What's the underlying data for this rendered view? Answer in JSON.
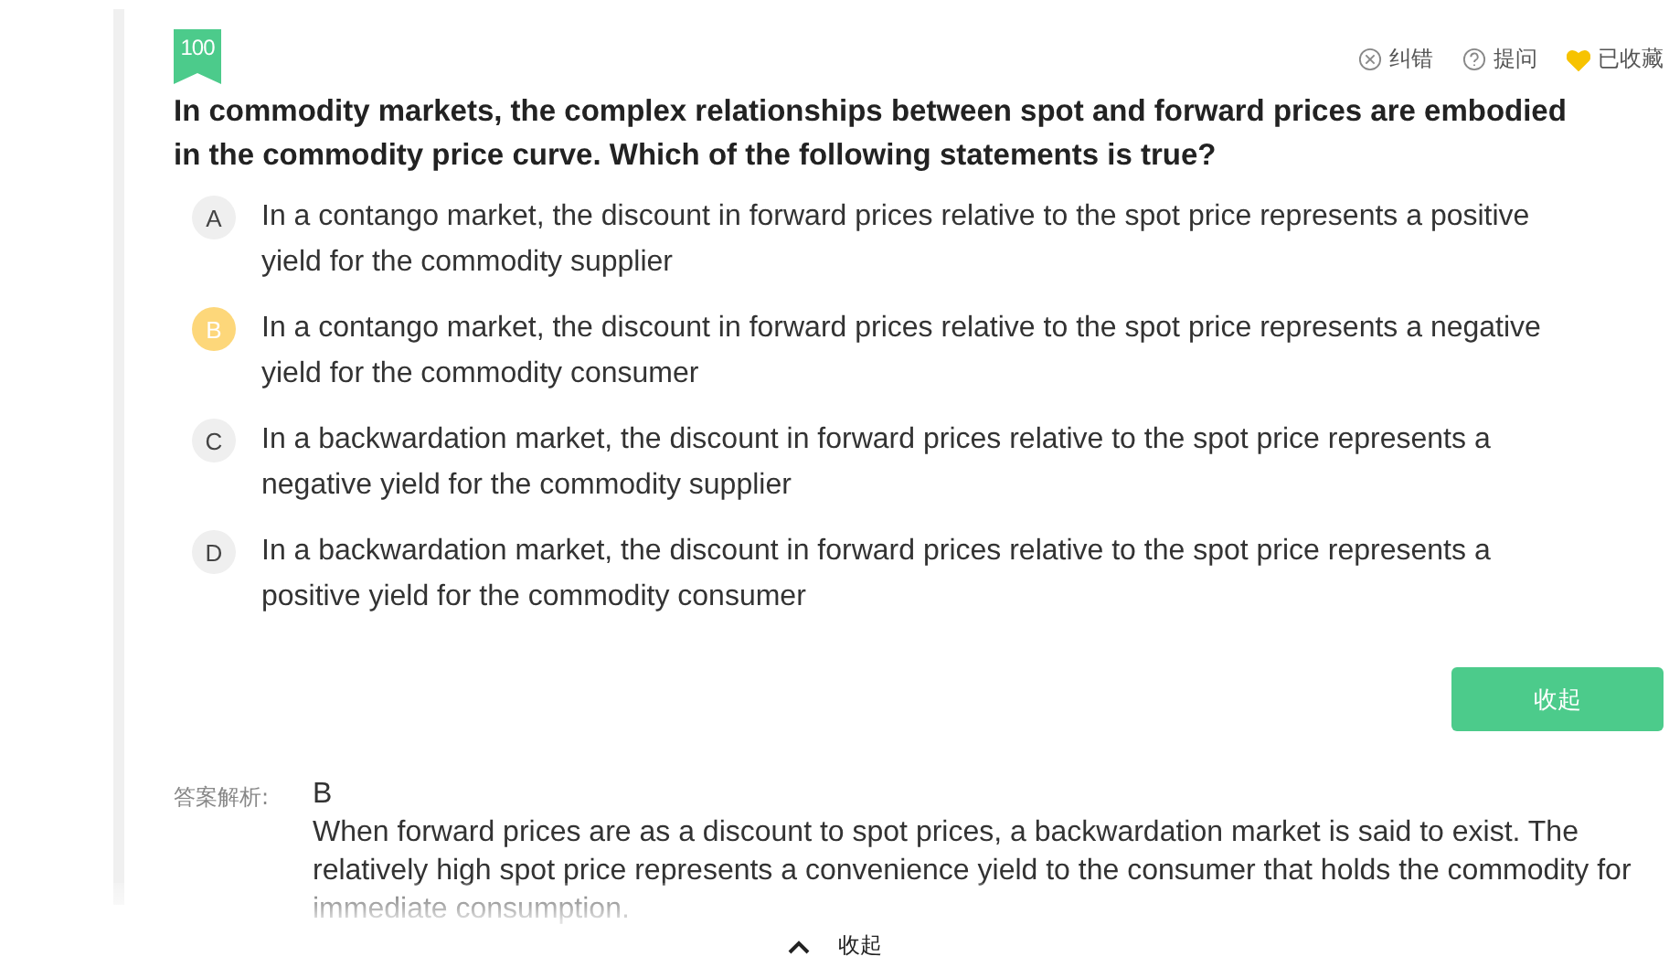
{
  "score_badge": "100",
  "actions": [
    {
      "kind": "error",
      "label": "纠错"
    },
    {
      "kind": "ask",
      "label": "提问"
    },
    {
      "kind": "favorite",
      "label": "已收藏",
      "on": true
    }
  ],
  "question": "In commodity markets, the complex relationships between spot and forward prices are embodied in the commodity price curve. Which of the following statements is true?",
  "options": [
    {
      "letter": "A",
      "text": "In a contango market, the discount in forward prices relative to the spot price represents a positive yield for the commodity supplier",
      "selected": false
    },
    {
      "letter": "B",
      "text": "In a contango market, the discount in forward prices relative to the spot price represents a negative yield for the commodity consumer",
      "selected": true
    },
    {
      "letter": "C",
      "text": "In a backwardation market, the discount in forward prices relative to the spot price represents a negative yield for the commodity supplier",
      "selected": false
    },
    {
      "letter": "D",
      "text": "In a backwardation market, the discount in forward prices relative to the spot price represents a positive yield for the commodity consumer",
      "selected": false
    }
  ],
  "collapse_button": "收起",
  "analysis": {
    "label": "答案解析:",
    "answer": "B",
    "text": "When forward prices are as a discount to spot prices, a backwardation market is said to exist. The relatively high spot price represents a convenience yield to the consumer that holds the commodity for immediate consumption."
  },
  "bottom_bar": {
    "label": "收起"
  }
}
